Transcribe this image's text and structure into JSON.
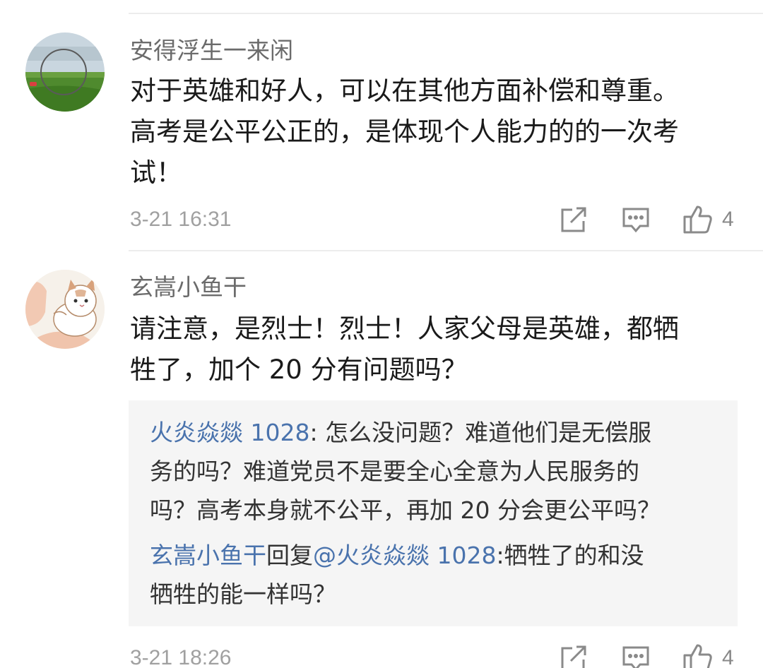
{
  "comments": [
    {
      "username": "安得浮生一来闲",
      "lines": [
        "对于英雄和好人，可以在其他方面补偿和尊重。",
        "高考是公平公正的，是体现个人能力的的一次考",
        "试！"
      ],
      "time": "3-21 16:31",
      "likes": "4",
      "actions": {
        "share_icon": "share-icon",
        "reply_icon": "comment-icon",
        "like_icon": "thumbs-up-icon"
      }
    },
    {
      "username": "玄嵩小鱼干",
      "lines": [
        "请注意，是烈士！烈士！人家父母是英雄，都牺",
        "牲了，加个 20 分有问题吗？"
      ],
      "replies": [
        {
          "name": "火炎焱燚 1028",
          "sep": ": ",
          "lines": [
            "怎么没问题？难道他们是无偿服",
            "务的吗？难道党员不是要全心全意为人民服务的",
            "吗？高考本身就不公平，再加 20 分会更公平吗？"
          ]
        },
        {
          "name": "玄嵩小鱼干",
          "verb": "回复",
          "target": "@火炎焱燚 1028",
          "sep": ":",
          "lines": [
            "牺牲了的和没",
            "牺牲的能一样吗？"
          ]
        }
      ],
      "time": "3-21 18:26",
      "likes": "4",
      "actions": {
        "share_icon": "share-icon",
        "reply_icon": "comment-icon",
        "like_icon": "thumbs-up-icon"
      }
    }
  ],
  "colors": {
    "link_blue": "#4a73ad",
    "username_gray": "#6b6b6b",
    "meta_gray": "#a0a0a0",
    "reply_bg": "#f5f5f5"
  }
}
